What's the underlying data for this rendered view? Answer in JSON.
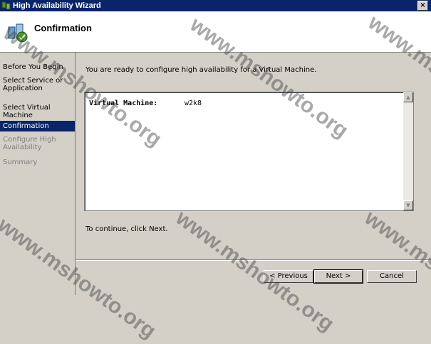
{
  "window": {
    "title": "High Availability Wizard",
    "close_glyph": "×"
  },
  "header": {
    "title": "Confirmation"
  },
  "sidebar": {
    "steps": [
      {
        "label": "Before You Begin",
        "state": "normal"
      },
      {
        "label": "Select Service or Application",
        "state": "normal"
      },
      {
        "label": "Select Virtual Machine",
        "state": "normal"
      },
      {
        "label": "Confirmation",
        "state": "active"
      },
      {
        "label": "Configure High Availability",
        "state": "disabled"
      },
      {
        "label": "Summary",
        "state": "disabled"
      }
    ]
  },
  "main": {
    "intro": "You are ready to configure high availability for a Virtual Machine.",
    "summary": {
      "label": "Virtual Machine:",
      "value": "w2k8"
    },
    "continue": "To continue, click Next."
  },
  "buttons": {
    "previous": "< Previous",
    "next": "Next >",
    "cancel": "Cancel"
  },
  "watermark": "www.mshowto.org",
  "colors": {
    "title_bar": "#0a246a",
    "active_step": "#0a246a",
    "face": "#d4d0c8"
  }
}
